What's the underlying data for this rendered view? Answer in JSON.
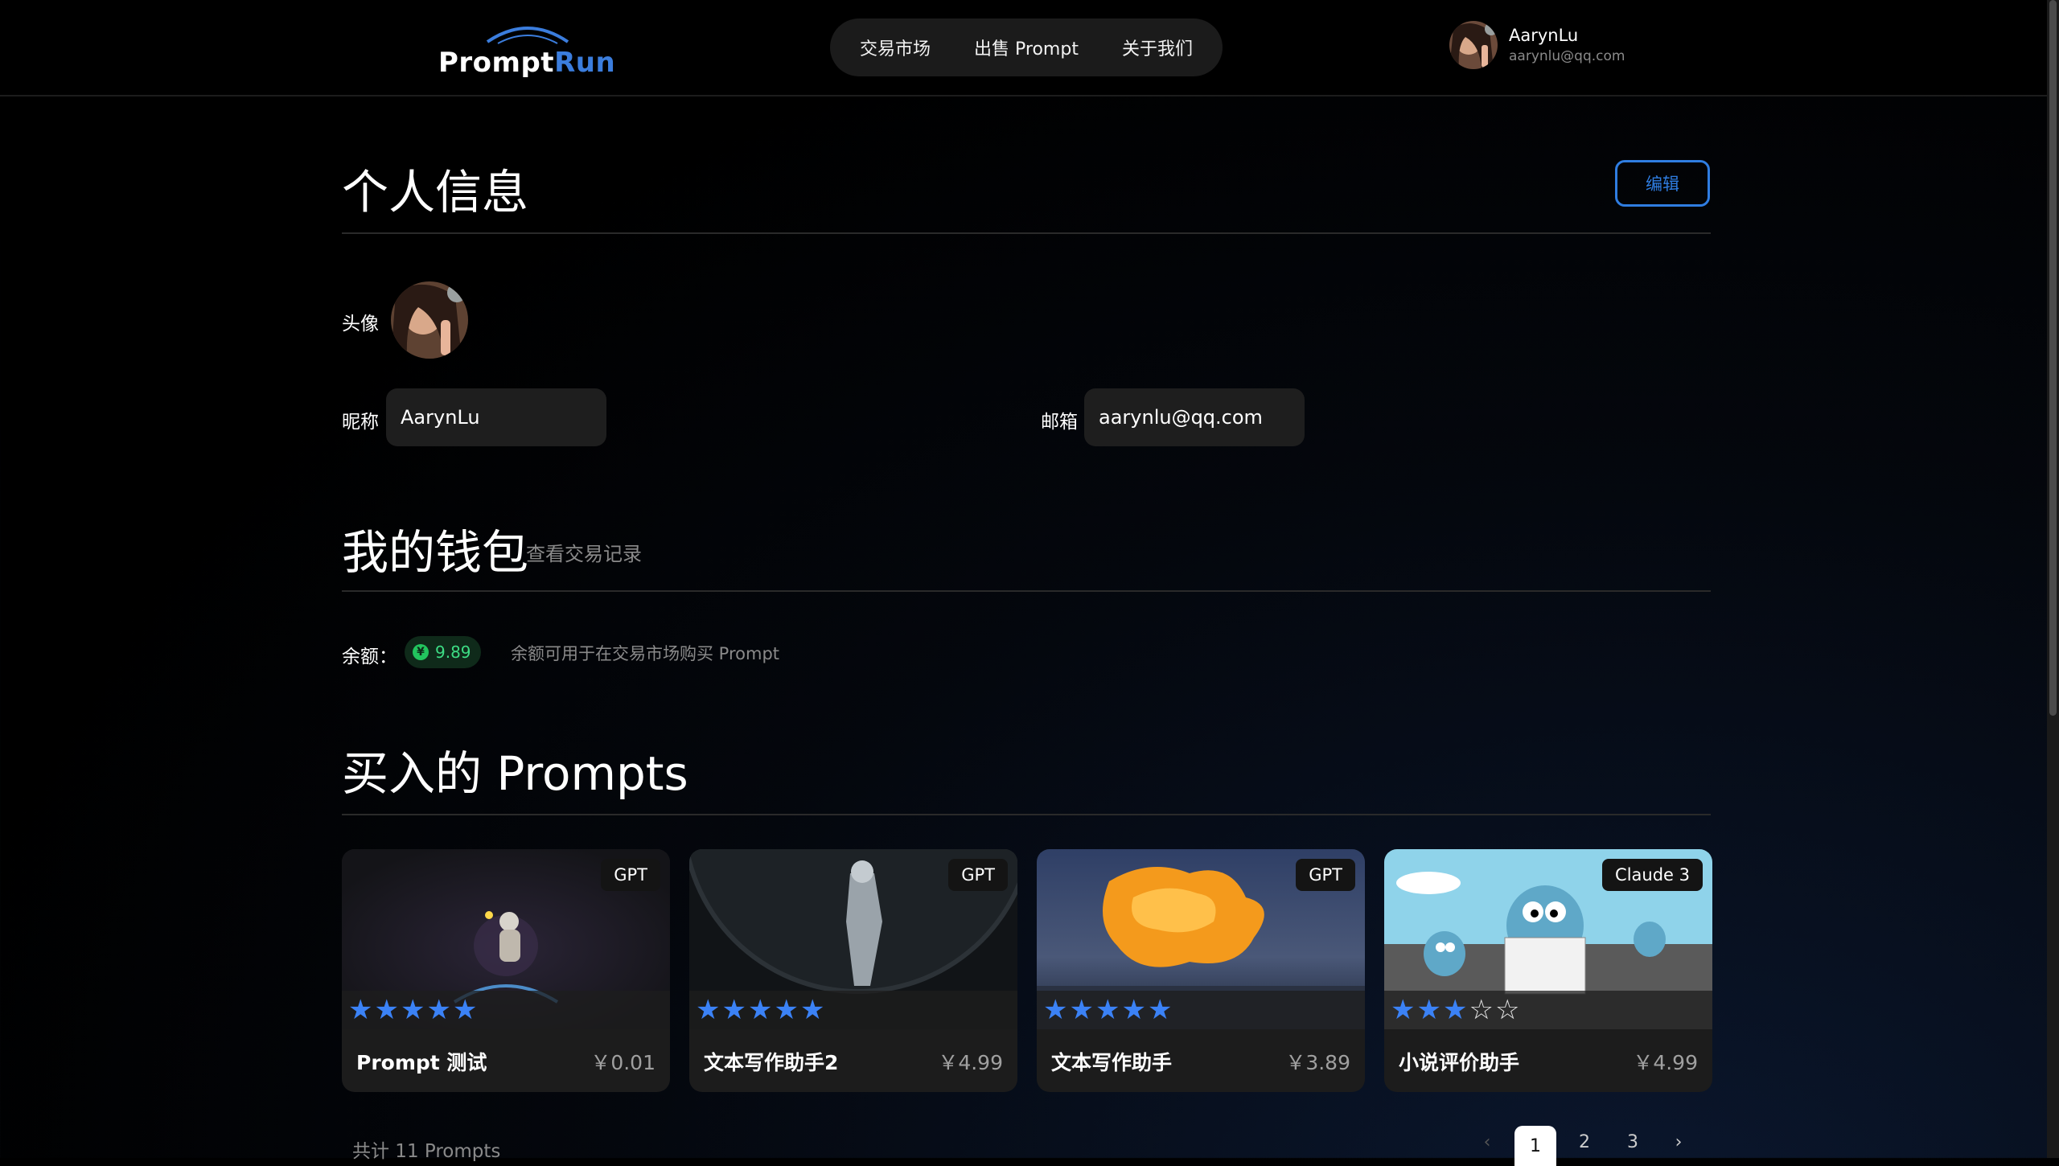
{
  "header": {
    "logo_part1": "Prompt",
    "logo_part2": "Run",
    "nav": [
      "交易市场",
      "出售 Prompt",
      "关于我们"
    ],
    "user_name": "AarynLu",
    "user_email": "aarynlu@qq.com"
  },
  "profile": {
    "title": "个人信息",
    "edit_label": "编辑",
    "avatar_label": "头像",
    "nickname_label": "昵称",
    "nickname_value": "AarynLu",
    "email_label": "邮箱",
    "email_value": "aarynlu@qq.com"
  },
  "wallet": {
    "title": "我的钱包",
    "history_link": "查看交易记录",
    "balance_label": "余额：",
    "balance_value": "9.89",
    "coin_symbol": "¥",
    "hint": "余额可用于在交易市场购买 Prompt"
  },
  "prompts": {
    "title": "买入的 Prompts",
    "cards": [
      {
        "title": "Prompt 测试",
        "price": "￥0.01",
        "badge": "GPT",
        "rating": 5
      },
      {
        "title": "文本写作助手2",
        "price": "￥4.99",
        "badge": "GPT",
        "rating": 5
      },
      {
        "title": "文本写作助手",
        "price": "￥3.89",
        "badge": "GPT",
        "rating": 5
      },
      {
        "title": "小说评价助手",
        "price": "￥4.99",
        "badge": "Claude 3",
        "rating": 3
      }
    ],
    "total": "共计 11 Prompts",
    "pages": [
      "1",
      "2",
      "3"
    ],
    "current_page": "1"
  },
  "colors": {
    "accent": "#2f7de1",
    "star": "#3b82f6",
    "balance_green": "#3ddc84"
  },
  "icons": [
    "prev-chevron-icon",
    "next-chevron-icon",
    "star-icon",
    "coin-icon"
  ]
}
